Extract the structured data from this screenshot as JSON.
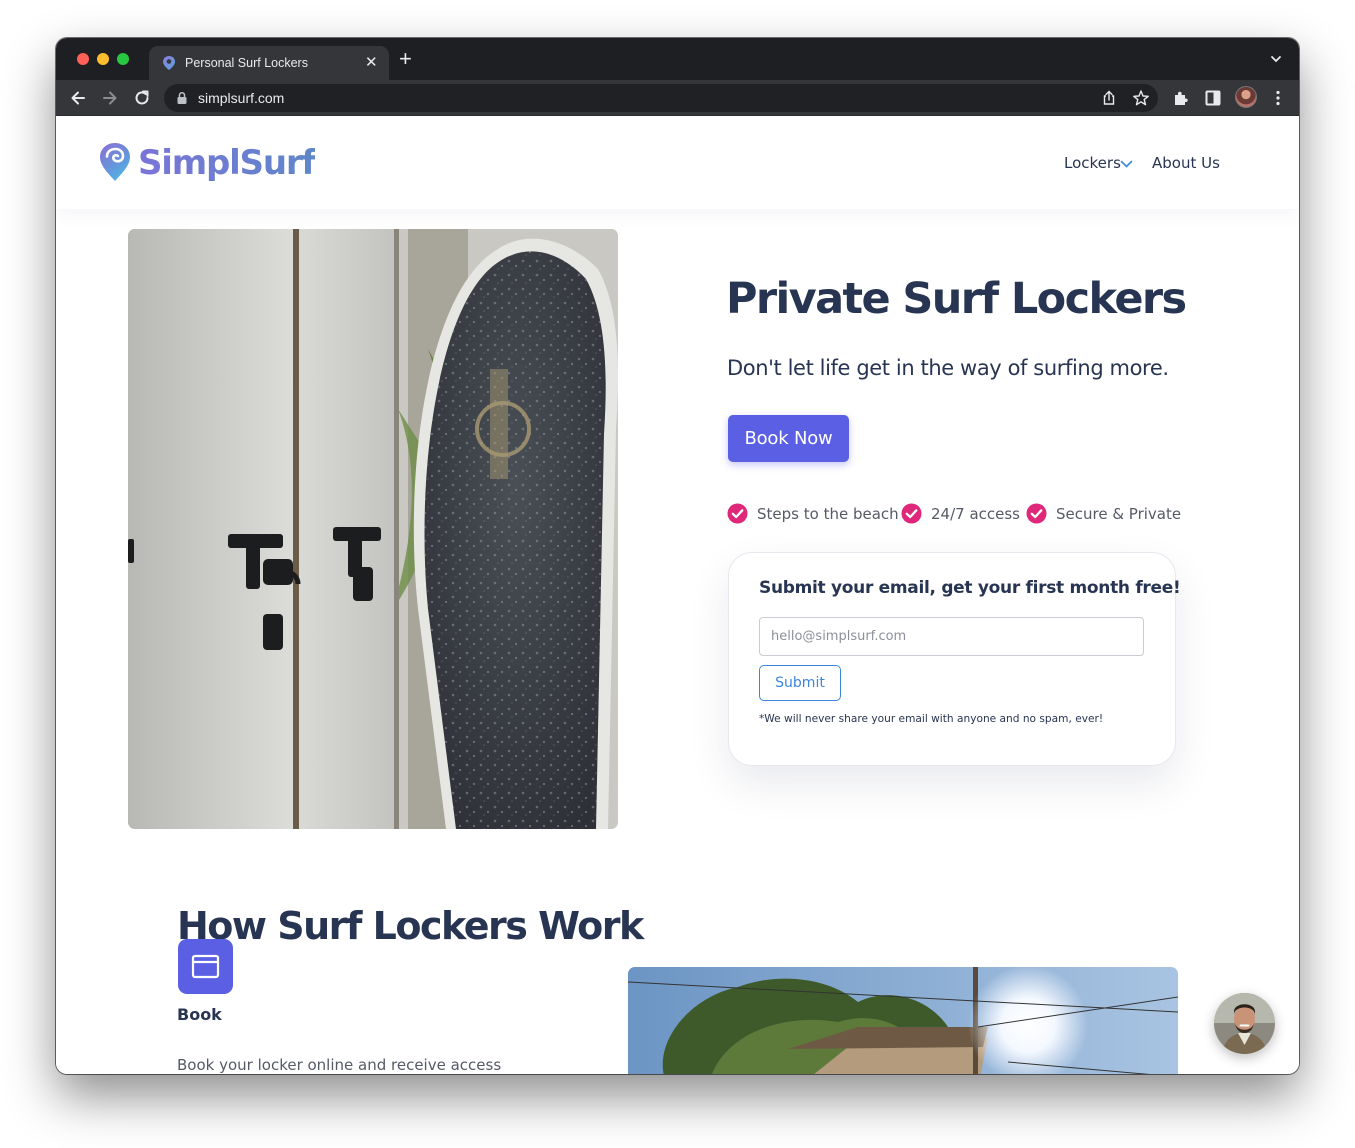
{
  "browser": {
    "tab_title": "Personal Surf Lockers",
    "url": "simplsurf.com",
    "icons": [
      "back-arrow-icon",
      "forward-arrow-icon",
      "reload-icon",
      "lock-icon",
      "share-icon",
      "star-icon",
      "extensions-icon",
      "sidebar-icon",
      "profile-avatar",
      "kebab-menu-icon",
      "tab-close-icon",
      "new-tab-icon",
      "tab-list-icon"
    ]
  },
  "site": {
    "logo_text": "SimplSurf",
    "nav": {
      "lockers": "Lockers",
      "about": "About Us"
    }
  },
  "hero": {
    "title": "Private Surf Lockers",
    "subtitle": "Don't let life get in the way of surfing more.",
    "book_button": "Book Now",
    "features": [
      "Steps to the beach",
      "24/7 access",
      "Secure & Private"
    ]
  },
  "signup": {
    "title": "Submit your email, get your first month free!",
    "placeholder": "hello@simplsurf.com",
    "submit": "Submit",
    "disclaimer": "*We will never share your email with anyone and no spam, ever!"
  },
  "how": {
    "title": "How Surf Lockers Work",
    "step_title": "Book",
    "step_desc": "Book your locker online and receive access"
  },
  "colors": {
    "primary": "#5a5fe4",
    "heading": "#283552",
    "check": "#e0287a",
    "link_blue": "#3c86d8"
  }
}
